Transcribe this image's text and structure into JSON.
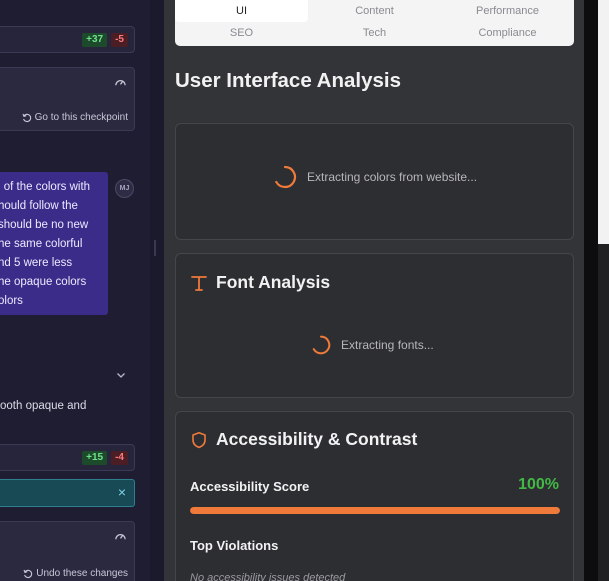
{
  "chat": {
    "diff_top": {
      "added": "+37",
      "removed": "-5"
    },
    "checkpoint_top": {
      "link": "Go to this checkpoint"
    },
    "message_lines": [
      "l of the colors with",
      "hould follow the",
      "should be no new",
      "he same colorful",
      "nd 5 were less",
      "he opaque colors",
      "olors"
    ],
    "avatar_initials": "MJ",
    "partial_text": "ooth opaque and",
    "diff_bottom": {
      "added": "+15",
      "removed": "-4"
    },
    "close_symbol": "×",
    "checkpoint_bottom": {
      "link": "Undo these changes"
    }
  },
  "tabs": [
    {
      "label": "UI",
      "active": true
    },
    {
      "label": "Content",
      "active": false
    },
    {
      "label": "Performance",
      "active": false
    },
    {
      "label": "SEO",
      "active": false
    },
    {
      "label": "Tech",
      "active": false
    },
    {
      "label": "Compliance",
      "active": false
    }
  ],
  "analysis": {
    "title": "User Interface Analysis",
    "colors_loading": "Extracting colors from website...",
    "font_card": {
      "title": "Font Analysis",
      "loading": "Extracting fonts..."
    },
    "accessibility_card": {
      "title": "Accessibility & Contrast",
      "score_label": "Accessibility Score",
      "score_value": "100%",
      "score_fraction": 1.0,
      "violations_label": "Top Violations",
      "no_issues": "No accessibility issues detected"
    }
  },
  "colors": {
    "accent": "#ef7a3a",
    "success": "#43b845",
    "message_bg": "#3b2c8a"
  }
}
